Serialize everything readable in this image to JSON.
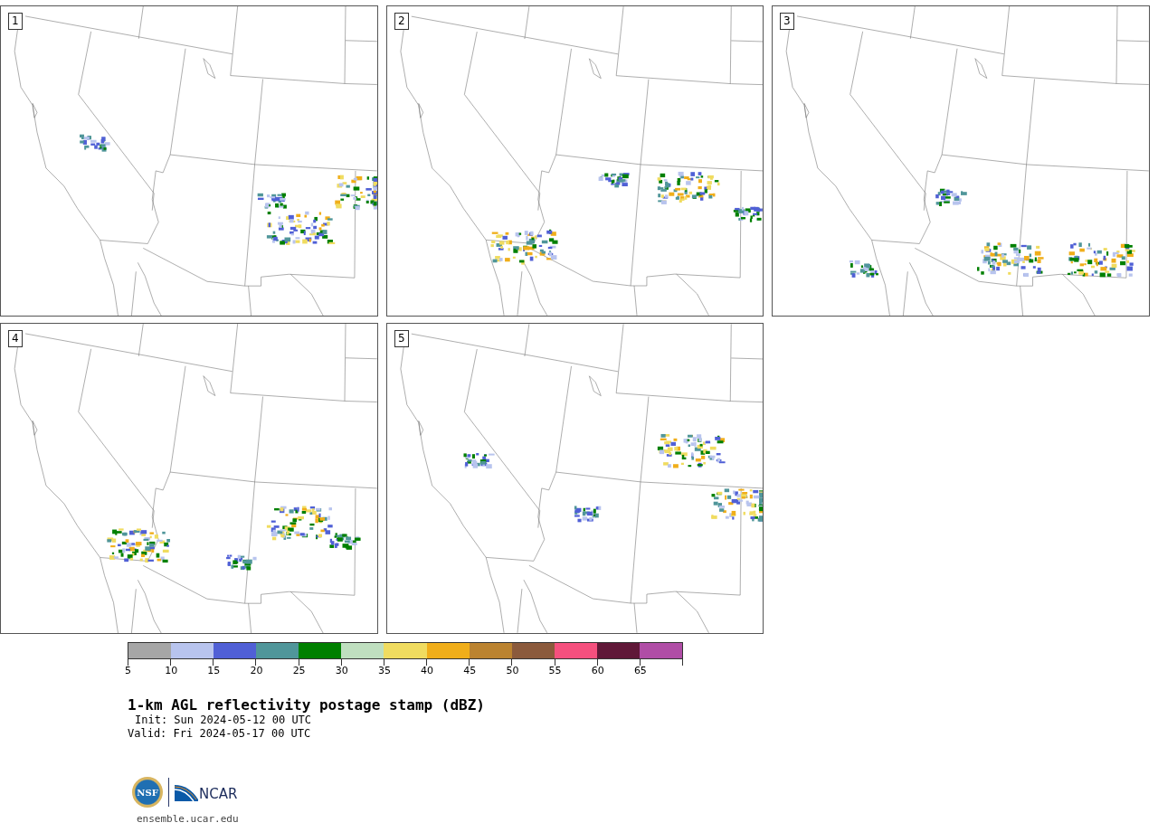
{
  "panels": [
    {
      "label": "1"
    },
    {
      "label": "2"
    },
    {
      "label": "3"
    },
    {
      "label": "4"
    },
    {
      "label": "5"
    }
  ],
  "colorbar": {
    "bins": [
      {
        "color": "#a6a6a6"
      },
      {
        "color": "#b8c4ee"
      },
      {
        "color": "#5060d6"
      },
      {
        "color": "#50969a"
      },
      {
        "color": "#008000"
      },
      {
        "color": "#bfdfbf"
      },
      {
        "color": "#f0dc60"
      },
      {
        "color": "#f0ae1a"
      },
      {
        "color": "#bb8330"
      },
      {
        "color": "#8b5a3c"
      },
      {
        "color": "#f5507e"
      },
      {
        "color": "#601838"
      },
      {
        "color": "#b04da6"
      }
    ],
    "ticks": [
      "5",
      "10",
      "15",
      "20",
      "25",
      "30",
      "35",
      "40",
      "45",
      "50",
      "55",
      "60",
      "65"
    ]
  },
  "title": "1-km AGL reflectivity postage stamp (dBZ)",
  "init": "Init: Sun 2024-05-12 00 UTC",
  "valid": "Valid: Fri 2024-05-17 00 UTC",
  "logos": {
    "nsf_text": "NSF",
    "ncar_text": "NCAR"
  },
  "website": "ensemble.ucar.edu"
}
